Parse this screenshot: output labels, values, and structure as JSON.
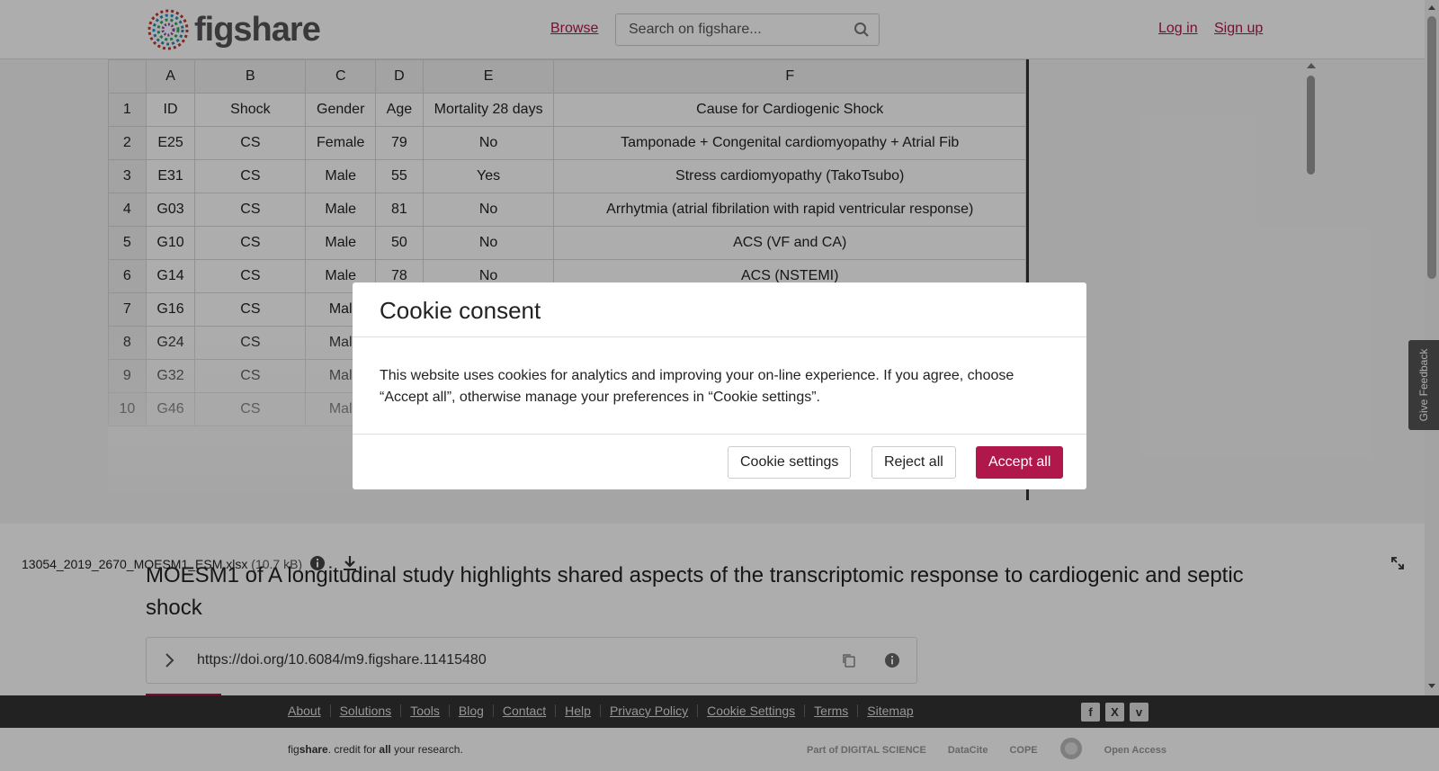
{
  "header": {
    "logo_text": "figshare",
    "browse_label": "Browse",
    "search_placeholder": "Search on figshare...",
    "login_label": "Log in",
    "signup_label": "Sign up"
  },
  "sheet": {
    "columns": [
      "A",
      "B",
      "C",
      "D",
      "E",
      "F"
    ],
    "rows": [
      {
        "n": "1",
        "cells": [
          "ID",
          "Shock",
          "Gender",
          "Age",
          "Mortality 28 days",
          "Cause for Cardiogenic Shock"
        ]
      },
      {
        "n": "2",
        "cells": [
          "E25",
          "CS",
          "Female",
          "79",
          "No",
          "Tamponade + Congenital cardiomyopathy + Atrial Fib"
        ]
      },
      {
        "n": "3",
        "cells": [
          "E31",
          "CS",
          "Male",
          "55",
          "Yes",
          "Stress cardiomyopathy (TakoTsubo)"
        ]
      },
      {
        "n": "4",
        "cells": [
          "G03",
          "CS",
          "Male",
          "81",
          "No",
          "Arrhytmia (atrial fibrilation with rapid ventricular response)"
        ]
      },
      {
        "n": "5",
        "cells": [
          "G10",
          "CS",
          "Male",
          "50",
          "No",
          "ACS (VF and CA)"
        ]
      },
      {
        "n": "6",
        "cells": [
          "G14",
          "CS",
          "Male",
          "78",
          "No",
          "ACS (NSTEMI)"
        ]
      },
      {
        "n": "7",
        "cells": [
          "G16",
          "CS",
          "Mal",
          "",
          "",
          ""
        ]
      },
      {
        "n": "8",
        "cells": [
          "G24",
          "CS",
          "Mal",
          "",
          "",
          ""
        ]
      },
      {
        "n": "9",
        "cells": [
          "G32",
          "CS",
          "Mal",
          "",
          "",
          ""
        ]
      },
      {
        "n": "10",
        "cells": [
          "G46",
          "CS",
          "Mal",
          "",
          "",
          ""
        ]
      }
    ]
  },
  "file": {
    "name": "13054_2019_2670_MOESM1_ESM.xlsx",
    "size": "(10.7 kB)"
  },
  "item": {
    "title": "MOESM1 of A longitudinal study highlights shared aspects of the transcriptomic response to cardiogenic and septic shock",
    "doi": "https://doi.org/10.6084/m9.figshare.11415480"
  },
  "feedback_label": "Give Feedback",
  "footer": {
    "links": [
      "About",
      "Solutions",
      "Tools",
      "Blog",
      "Contact",
      "Help",
      "Privacy Policy",
      "Cookie Settings",
      "Terms",
      "Sitemap"
    ],
    "social": [
      "f",
      "X",
      "v"
    ],
    "tagline_pre": "fig",
    "tagline_brand": "share",
    "tagline_mid": ". credit for ",
    "tagline_all": "all",
    "tagline_post": " your research.",
    "partners": [
      "Part of DIGITAL SCIENCE",
      "DataCite",
      "COPE",
      "",
      "Open Access"
    ]
  },
  "cookie_modal": {
    "title": "Cookie consent",
    "body": "This website uses cookies for analytics and improving your on-line experience. If you agree, choose “Accept all”, otherwise manage your preferences in “Cookie settings”.",
    "settings_label": "Cookie settings",
    "reject_label": "Reject all",
    "accept_label": "Accept all"
  },
  "colors": {
    "brand": "#b0174a",
    "footer_bg": "#333333"
  }
}
